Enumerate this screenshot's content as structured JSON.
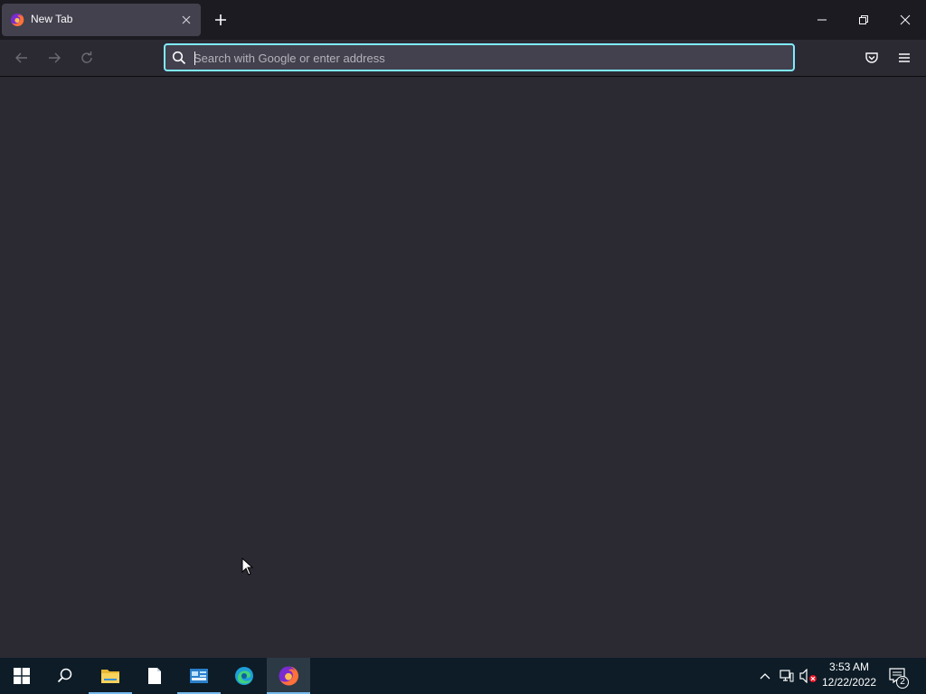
{
  "browser": {
    "tabs": [
      {
        "title": "New Tab",
        "favicon": "firefox-icon",
        "active": true
      }
    ],
    "new_tab_icon": "plus-icon",
    "window_controls": [
      "minimize-icon",
      "restore-icon",
      "close-icon"
    ],
    "nav": {
      "back_icon": "back-arrow-icon",
      "forward_icon": "forward-arrow-icon",
      "reload_icon": "reload-icon",
      "pocket_icon": "pocket-icon",
      "menu_icon": "hamburger-menu-icon"
    },
    "urlbar": {
      "placeholder": "Search with Google or enter address",
      "value": "",
      "focused": true,
      "focus_color": "#80ebff"
    },
    "theme": {
      "tabbar_bg": "#1c1b22",
      "toolbar_bg": "#2b2a33",
      "content_bg": "#2b2a33"
    }
  },
  "taskbar": {
    "items": [
      {
        "name": "start",
        "icon": "windows-start-icon",
        "running": false,
        "active": false
      },
      {
        "name": "search",
        "icon": "search-icon",
        "running": false,
        "active": false
      },
      {
        "name": "file-explorer",
        "icon": "folder-icon",
        "running": true,
        "active": false
      },
      {
        "name": "notepad",
        "icon": "document-icon",
        "running": false,
        "active": false
      },
      {
        "name": "control-panel",
        "icon": "control-panel-icon",
        "running": true,
        "active": false
      },
      {
        "name": "edge",
        "icon": "edge-icon",
        "running": false,
        "active": false
      },
      {
        "name": "firefox",
        "icon": "firefox-icon",
        "running": true,
        "active": true
      }
    ],
    "tray": {
      "chevron_icon": "chevron-up-icon",
      "network_icon": "network-icon",
      "volume_icon": "volume-muted-icon",
      "time": "3:53 AM",
      "date": "12/22/2022",
      "notifications_icon": "notification-center-icon",
      "notifications_count": "2"
    },
    "accent": "#76b9ed",
    "bg": "#0d1c27"
  }
}
